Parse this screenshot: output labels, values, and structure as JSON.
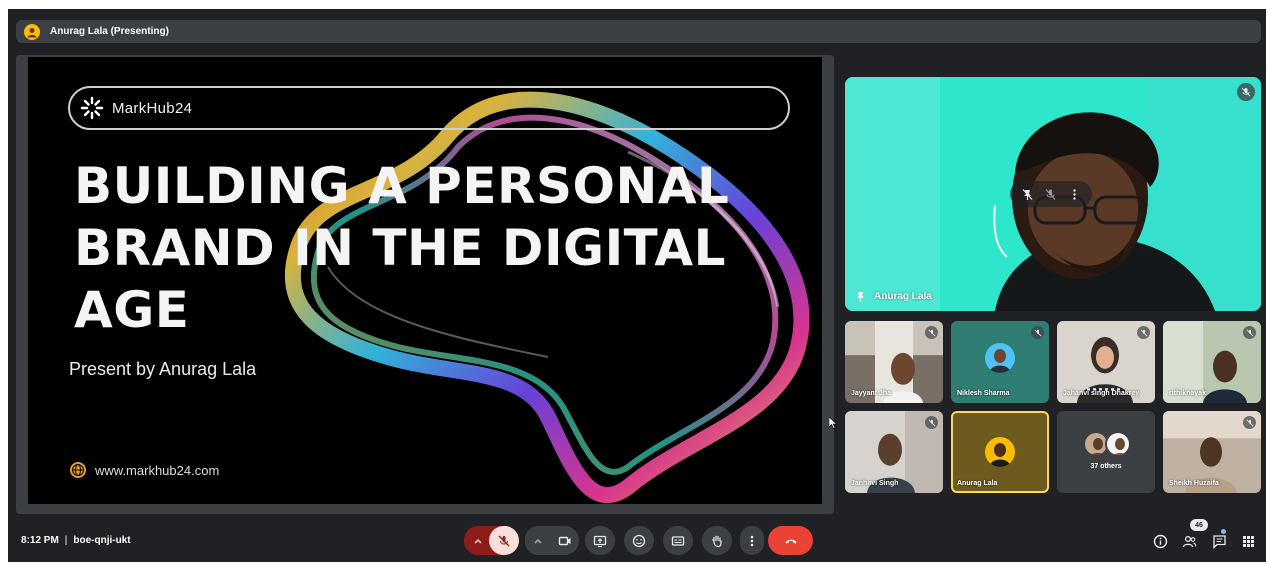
{
  "presenter_bar": {
    "label": "Anurag Lala (Presenting)"
  },
  "slide": {
    "brand": "MarkHub24",
    "title_lines": [
      "BUILDING A PERSONAL",
      "BRAND IN THE DIGITAL",
      "AGE"
    ],
    "subtitle": "Present by Anurag Lala",
    "website": "www.markhub24.com"
  },
  "main_tile": {
    "name": "Anurag Lala",
    "bg_color": "#2ee6cc"
  },
  "participants": [
    {
      "name": "Jayyant Jha"
    },
    {
      "name": "Niklesh Sharma"
    },
    {
      "name": "Jahanvi singh Dhakrey"
    },
    {
      "name": "rithiknayak"
    },
    {
      "name": "Janhavi Singh"
    },
    {
      "name": "Anurag Lala"
    },
    {
      "name": "37 others"
    },
    {
      "name": "Sheikh Huzaifa"
    }
  ],
  "bottom_bar": {
    "time": "8:12 PM",
    "separator": "|",
    "meeting_code": "boe-qnji-ukt",
    "people_count": "46"
  },
  "colors": {
    "end_call": "#ea4335",
    "bar_bg": "#202124",
    "button_bg": "#3c4043",
    "active_outline": "#fbd75b"
  },
  "icons": [
    "mic-off-icon",
    "chevron-up-icon",
    "camera-icon",
    "present-icon",
    "emoji-icon",
    "captions-icon",
    "raise-hand-icon",
    "more-vert-icon",
    "end-call-icon",
    "info-icon",
    "people-icon",
    "chat-icon",
    "activities-icon",
    "pin-icon",
    "globe-icon"
  ]
}
